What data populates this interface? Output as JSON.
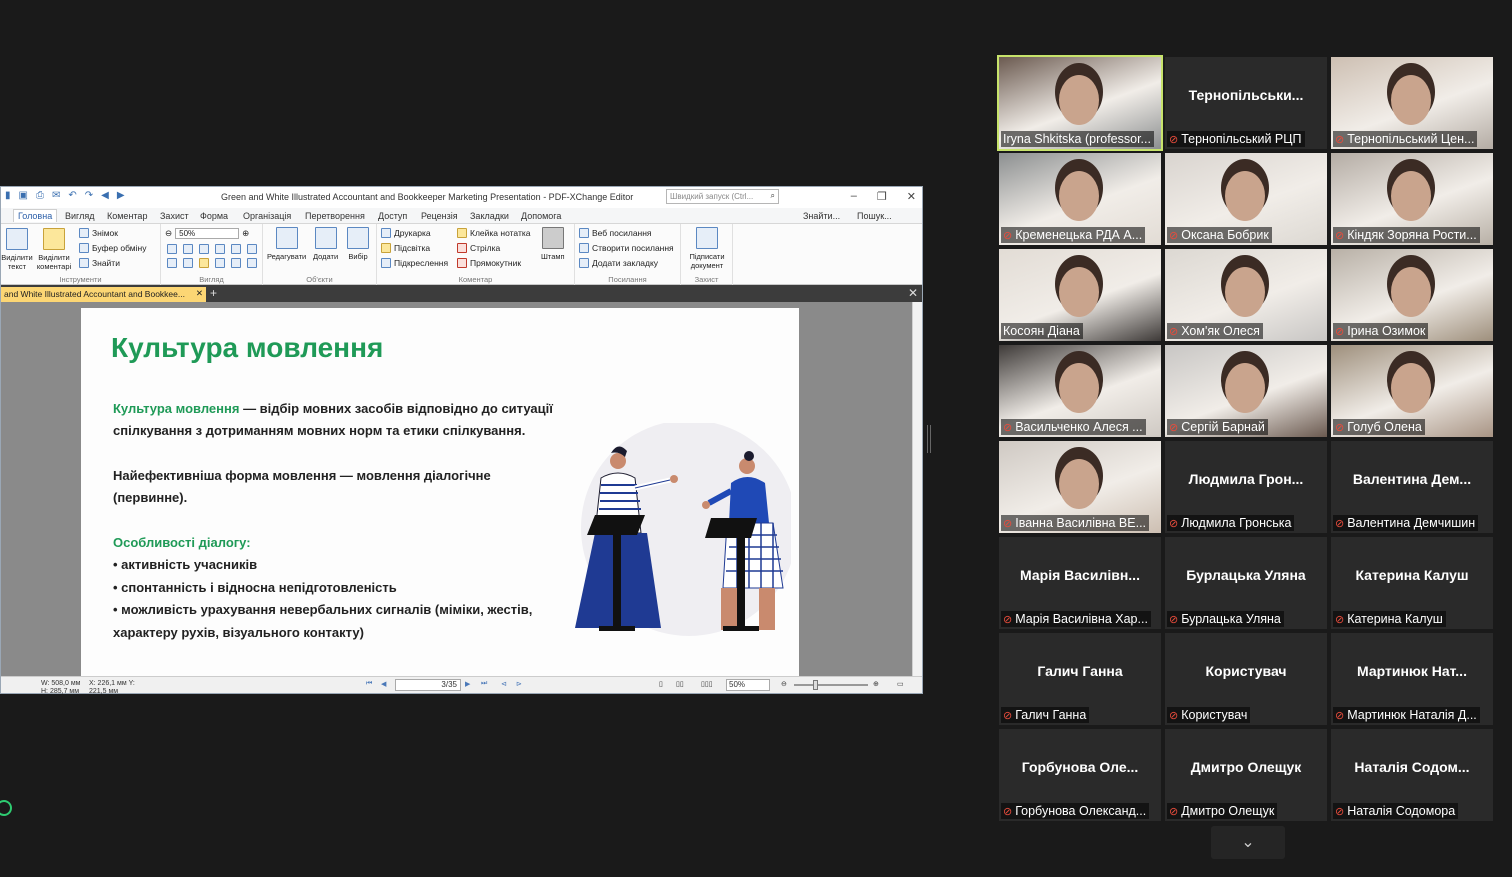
{
  "app": {
    "title": "Green and White Illustrated Accountant and Bookkeeper Marketing Presentation - PDF-XChange Editor",
    "quick_launch_placeholder": "Швидкий запуск (Ctrl...",
    "menu": [
      "Головна",
      "Вигляд",
      "Коментар",
      "Захист",
      "Форма",
      "Організація",
      "Перетворення",
      "Доступ",
      "Рецензія",
      "Закладки",
      "Допомога"
    ],
    "menu_right": [
      "Знайти...",
      "Пошук..."
    ],
    "ribbon": {
      "tools_group": "Інструменти",
      "select_text": "Виділити текст",
      "select_comments": "Виділити коментарі",
      "snapshot": "Знімок",
      "clipboard": "Буфер обміну",
      "find": "Знайти",
      "view_group": "Вигляд",
      "zoom": "50%",
      "objects_group": "Об'єкти",
      "edit": "Редагувати",
      "add": "Додати",
      "select": "Вибір",
      "comment_group": "Коментар",
      "typewriter": "Друкарка",
      "highlight": "Підсвітка",
      "underline": "Підкреслення",
      "sticky_note": "Клейка нотатка",
      "arrow": "Стрілка",
      "rectangle": "Прямокутник",
      "stamp": "Штамп",
      "links_group": "Посилання",
      "web_links": "Веб посилання",
      "create_link": "Створити посилання",
      "add_bookmark": "Додати закладку",
      "protect_group": "Захист",
      "sign_document": "Підписати документ"
    },
    "doc_tab": "and White Illustrated Accountant and Bookkee...",
    "status": {
      "size": "W: 508,0 мм  H: 285,7 мм",
      "coords": "X: 226,1 мм  Y: 221,5 мм",
      "page": "3/35",
      "zoom": "50%"
    }
  },
  "slide": {
    "title": "Культура мовлення",
    "def_term": "Культура мовлення",
    "def_rest1": " — відбір мовних засобів відповідно до ситуації",
    "def_line2": "спілкування з дотриманням мовних норм та етики спілкування.",
    "effective1": "Найефективніша форма мовлення — мовлення діалогічне",
    "effective2": "(первинне).",
    "features_title": "Особливості діалогу:",
    "bullet1": "• активність учасників",
    "bullet2": "• спонтанність і відносна непідготовленість",
    "bullet3": "• можливість урахування невербальних сигналів  (міміки, жестів,",
    "bullet3b": "характеру рухів, візуального контакту)"
  },
  "gallery": [
    {
      "label": "Iryna Shkitska (professor...",
      "video": true,
      "muted": false,
      "active": true
    },
    {
      "label": "Тернопільський РЦП",
      "big": "Тернопільськи...",
      "muted": true
    },
    {
      "label": "Тернопільський Цен...",
      "video": true,
      "muted": true
    },
    {
      "label": "Кременецька РДА А...",
      "video": true,
      "muted": true
    },
    {
      "label": "Оксана Бобрик",
      "video": true,
      "muted": true
    },
    {
      "label": "Кіндяк Зоряна Рости...",
      "video": true,
      "muted": true
    },
    {
      "label": "Косоян Діана",
      "video": true,
      "muted": false
    },
    {
      "label": "Хом'як Олеся",
      "video": true,
      "muted": true
    },
    {
      "label": "Ірина Озимок",
      "video": true,
      "muted": true
    },
    {
      "label": "Васильченко Алеся ...",
      "video": true,
      "muted": true
    },
    {
      "label": "Сергій Барнай",
      "video": true,
      "muted": true
    },
    {
      "label": "Голуб Олена",
      "video": true,
      "muted": true
    },
    {
      "label": "Іванна Василівна ВЕ...",
      "video": true,
      "muted": true
    },
    {
      "label": "Людмила Гронська",
      "big": "Людмила  Грон...",
      "muted": true
    },
    {
      "label": "Валентина Демчишин",
      "big": "Валентина  Дем...",
      "muted": true
    },
    {
      "label": "Марія Василівна Хар...",
      "big": "Марія  Василівн...",
      "muted": true
    },
    {
      "label": "Бурлацька Уляна",
      "big": "Бурлацька Уляна",
      "muted": true
    },
    {
      "label": "Катерина Калуш",
      "big": "Катерина Калуш",
      "muted": true
    },
    {
      "label": "Галич Ганна",
      "big": "Галич Ганна",
      "muted": true
    },
    {
      "label": "Користувач",
      "big": "Користувач",
      "muted": true
    },
    {
      "label": "Мартинюк Наталія Д...",
      "big": "Мартинюк  Нат...",
      "muted": true
    },
    {
      "label": "Горбунова Олександ...",
      "big": "Горбунова  Оле...",
      "muted": true
    },
    {
      "label": "Дмитро Олещук",
      "big": "Дмитро Олещук",
      "muted": true
    },
    {
      "label": "Наталія Содомора",
      "big": "Наталія  Содом...",
      "muted": true
    }
  ]
}
